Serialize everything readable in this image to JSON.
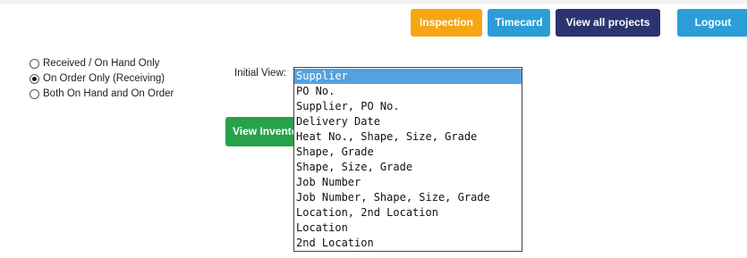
{
  "nav": {
    "inspection": "Inspection",
    "timecard": "Timecard",
    "view_all_projects": "View all projects",
    "logout": "Logout"
  },
  "filter": {
    "options": [
      {
        "label": "Received / On Hand Only",
        "checked": false
      },
      {
        "label": "On Order Only (Receiving)",
        "checked": true
      },
      {
        "label": "Both On Hand and On Order",
        "checked": false
      }
    ]
  },
  "initial_view": {
    "label": "Initial View:",
    "selected": "Supplier",
    "options": [
      "Supplier",
      "PO No.",
      "Supplier, PO No.",
      "Delivery Date",
      "Heat No., Shape, Size, Grade",
      "Shape, Grade",
      "Shape, Size, Grade",
      "Job Number",
      "Job Number, Shape, Size, Grade",
      "Location, 2nd Location",
      "Location",
      "2nd Location"
    ]
  },
  "view_inventory_button": "View Inventory",
  "colors": {
    "inspection": "#f7a613",
    "timecard": "#2b9ed8",
    "projects": "#2a3570",
    "logout": "#2b9ed8",
    "view_inventory": "#27a24a",
    "selected_option": "#55a1e0"
  }
}
